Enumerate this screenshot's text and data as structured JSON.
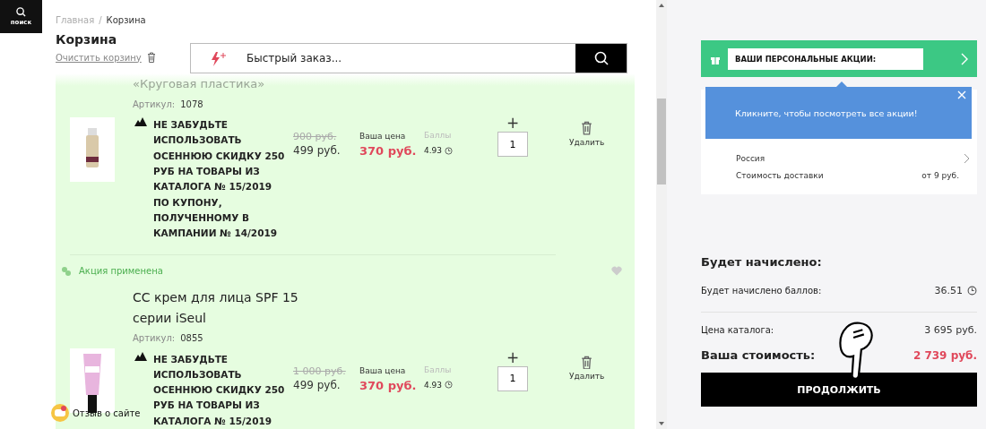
{
  "search_button": {
    "label": "поиск"
  },
  "breadcrumbs": [
    "Главная",
    "Корзина"
  ],
  "breadcrumb_separator": "/",
  "cart": {
    "title": "Корзина",
    "clear_link": "Очистить корзину"
  },
  "quick_order": {
    "placeholder": "Быстрый заказ..."
  },
  "items": [
    {
      "name_lines": [
        "«Круговая пластика»"
      ],
      "name_faded": true,
      "article_label": "Артикул:",
      "article": "1078",
      "kind": "bottle",
      "promo": "НЕ ЗАБУДЬТЕ ИСПОЛЬЗОВАТЬ ОСЕННЮЮ СКИДКУ 250 РУБ НА ТОВАРЫ ИЗ КАТАЛОГА № 15/2019 ПО КУПОНУ, ПОЛУЧЕННОМУ В КАМПАНИИ № 14/2019",
      "old_price": "900 руб.",
      "price": "499 руб.",
      "your_price_label": "Ваша цена",
      "your_price": "370 руб.",
      "points_label": "Баллы",
      "points": "4.93",
      "qty_plus": "+",
      "qty": "1",
      "delete": "Удалить"
    },
    {
      "badge": "Акция применена",
      "favorite": false,
      "name_lines": [
        "CC крем для лица SPF 15",
        "серии iSeul"
      ],
      "name_faded": false,
      "article_label": "Артикул:",
      "article": "0855",
      "kind": "tube",
      "promo": "НЕ ЗАБУДЬТЕ ИСПОЛЬЗОВАТЬ ОСЕННЮЮ СКИДКУ 250 РУБ НА ТОВАРЫ ИЗ КАТАЛОГА № 15/2019",
      "old_price": "1 000 руб.",
      "price": "499 руб.",
      "your_price_label": "Ваша цена",
      "your_price": "370 руб.",
      "points_label": "Баллы",
      "points": "4.93",
      "qty_plus": "+",
      "qty": "1",
      "delete": "Удалить"
    }
  ],
  "feedback": {
    "label": "Отзыв о сайте"
  },
  "promo_banner": {
    "label": "ВАШИ ПЕРСОНАЛЬНЫЕ АКЦИИ:"
  },
  "tooltip": {
    "text": "Кликните, чтобы посмотреть все акции!"
  },
  "delivery": {
    "country": "Россия",
    "cost_label": "Стоимость доставки",
    "cost": "от 9 руб."
  },
  "summary": {
    "heading": "Будет начислено:",
    "points_label": "Будет начислено баллов:",
    "points": "36.51",
    "catalog_label": "Цена каталога:",
    "catalog": "3 695 руб.",
    "total_label": "Ваша стоимость:",
    "total": "2 739 руб.",
    "continue": "ПРОДОЛЖИТЬ"
  }
}
